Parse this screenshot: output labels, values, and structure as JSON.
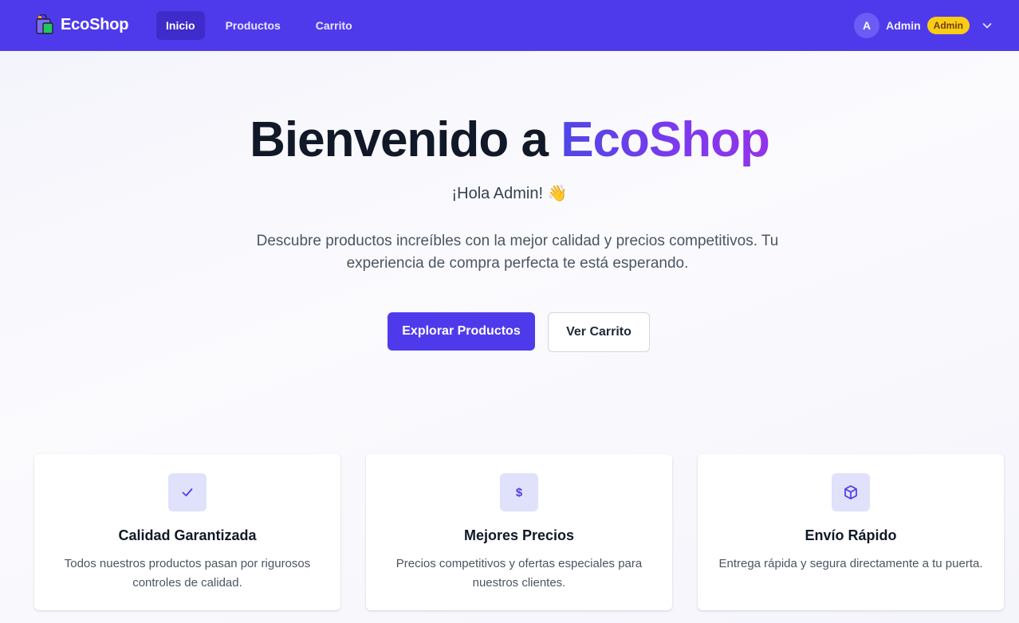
{
  "navbar": {
    "brand": "EcoShop",
    "links": [
      {
        "label": "Inicio",
        "active": true
      },
      {
        "label": "Productos",
        "active": false
      },
      {
        "label": "Carrito",
        "active": false
      }
    ],
    "user": {
      "avatar_initial": "A",
      "name": "Admin",
      "role_badge": "Admin"
    }
  },
  "hero": {
    "title_prefix": "Bienvenido a ",
    "title_accent": "EcoShop",
    "greeting": "¡Hola Admin! 👋",
    "description": "Descubre productos increíbles con la mejor calidad y precios competitivos. Tu experiencia de compra perfecta te está esperando.",
    "primary_button": "Explorar Productos",
    "secondary_button": "Ver Carrito"
  },
  "features": [
    {
      "icon": "check-icon",
      "title": "Calidad Garantizada",
      "text": "Todos nuestros productos pasan por rigurosos controles de calidad."
    },
    {
      "icon": "dollar-icon",
      "title": "Mejores Precios",
      "text": "Precios competitivos y ofertas especiales para nuestros clientes."
    },
    {
      "icon": "box-icon",
      "title": "Envío Rápido",
      "text": "Entrega rápida y segura directamente a tu puerta."
    }
  ],
  "colors": {
    "navbar": "#4f3aeb",
    "accent_gradient_start": "#4f46e5",
    "accent_gradient_end": "#9333ea",
    "badge": "#facc15"
  }
}
